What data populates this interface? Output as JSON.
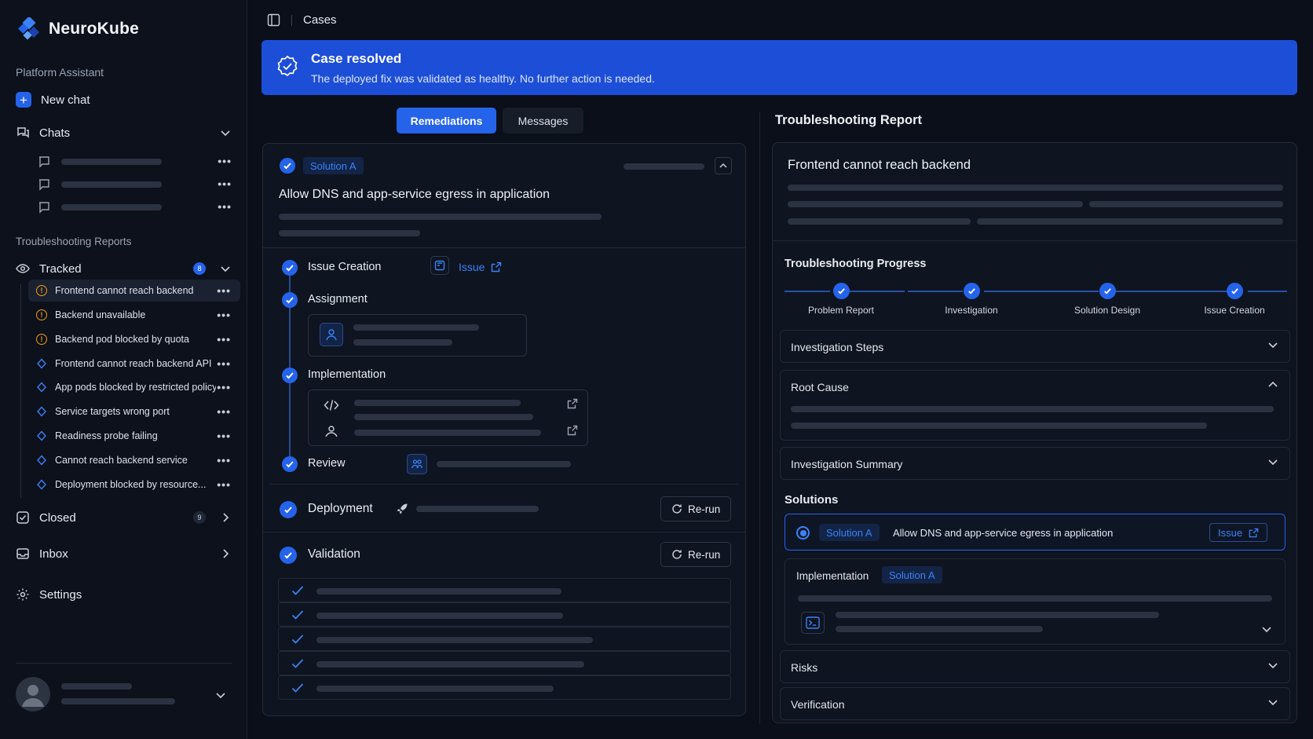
{
  "brand": {
    "name": "NeuroKube"
  },
  "sidebar": {
    "assistant_label": "Platform Assistant",
    "new_chat": "New chat",
    "chats": "Chats",
    "reports_label": "Troubleshooting Reports",
    "tracked": {
      "label": "Tracked",
      "count": "8"
    },
    "reports": [
      {
        "label": "Frontend cannot reach backend",
        "icon": "warning-icon"
      },
      {
        "label": "Backend unavailable",
        "icon": "warning-icon"
      },
      {
        "label": "Backend pod blocked by quota",
        "icon": "warning-icon"
      },
      {
        "label": "Frontend cannot reach backend API",
        "icon": "kube-icon"
      },
      {
        "label": "App pods blocked by restricted policy",
        "icon": "kube-icon"
      },
      {
        "label": "Service targets wrong port",
        "icon": "kube-icon"
      },
      {
        "label": "Readiness probe failing",
        "icon": "kube-icon"
      },
      {
        "label": "Cannot reach backend service",
        "icon": "kube-icon"
      },
      {
        "label": "Deployment blocked by resource...",
        "icon": "kube-icon"
      }
    ],
    "closed": {
      "label": "Closed",
      "count": "9"
    },
    "inbox": "Inbox",
    "settings": "Settings",
    "more": "•••"
  },
  "header": {
    "breadcrumb": "Cases"
  },
  "banner": {
    "title": "Case resolved",
    "subtitle": "The deployed fix was validated as healthy. No further action is needed."
  },
  "tabs": {
    "remediations": "Remediations",
    "messages": "Messages"
  },
  "remediation": {
    "solution_tag": "Solution A",
    "title": "Allow DNS and app-service egress in application",
    "steps": {
      "issue_creation": "Issue Creation",
      "issue_link": "Issue",
      "assignment": "Assignment",
      "implementation": "Implementation",
      "review": "Review",
      "deployment": "Deployment",
      "validation": "Validation"
    },
    "rerun": "Re-run"
  },
  "report": {
    "heading": "Troubleshooting Report",
    "title": "Frontend cannot reach backend",
    "progress_title": "Troubleshooting Progress",
    "progress": [
      "Problem Report",
      "Investigation",
      "Solution Design",
      "Issue Creation"
    ],
    "sections": {
      "investigation_steps": "Investigation Steps",
      "root_cause": "Root Cause",
      "investigation_summary": "Investigation Summary",
      "solutions": "Solutions",
      "risks": "Risks",
      "verification": "Verification"
    },
    "solution": {
      "tag": "Solution A",
      "text": "Allow DNS and app-service egress in application",
      "issue": "Issue"
    },
    "implementation": {
      "label": "Implementation",
      "tag": "Solution A"
    }
  },
  "colors": {
    "accent": "#2563eb",
    "banner": "#1d4ed8",
    "warning": "#f59e0b",
    "background": "#0a0f1a"
  }
}
